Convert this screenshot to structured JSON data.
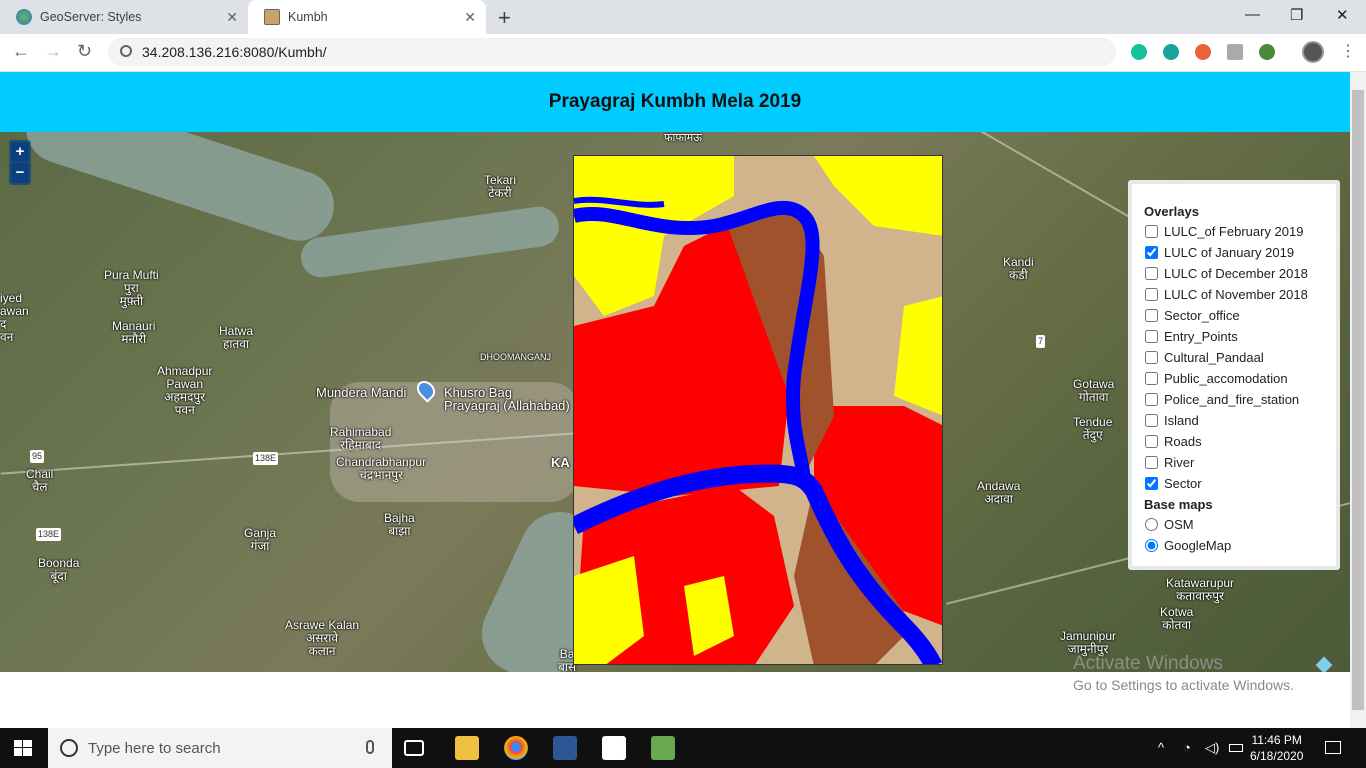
{
  "browser": {
    "tabs": [
      {
        "title": "GeoServer: Styles",
        "active": false
      },
      {
        "title": "Kumbh",
        "active": true
      }
    ],
    "url": "34.208.136.216:8080/Kumbh/",
    "new_tab_icon": "+",
    "back_icon": "←",
    "forward_icon": "→",
    "reload_icon": "↻",
    "minimize_icon": "—",
    "restore_icon": "❐",
    "close_icon": "✕"
  },
  "page": {
    "title": "Prayagraj Kumbh Mela 2019"
  },
  "map": {
    "zoom_in": "+",
    "zoom_out": "−",
    "places": [
      "Tekari\nटेकरी",
      "Pura Mufti\nपुरा\nमुफ़्ती",
      "Manauri\nमनौरी",
      "Hatwa\nहातवा",
      "Ahmadpur\nPawan\nअहमदपुर\nपवन",
      "Mundera Mandi",
      "Khusro Bag\nPrayagraj (Allahabad)",
      "Rahimabad\nरहिमाबाद",
      "Chandrabhanpur\nचंद्रभानपुर",
      "Bajha\nबाझा",
      "Ganja\nगंजा",
      "Boonda\nबूंदा",
      "Chail\nचैल",
      "Asrawe Kalan\nअसरावे\nकलान",
      "Kandi\nकंडी",
      "Gotawa\nगोतावा",
      "Tendue\nतेंदुए",
      "Andawa\nअदावा",
      "Katawarupur\nकतावारुपुर",
      "Kotwa\nकोतवा",
      "Jamunipur\nजामुनीपुर",
      "DHOOMANGANJ",
      "KA",
      "Ba\nबास",
      "iyed\nawan\nद\nवन",
      "फाफामऊ\nरूदापुर"
    ],
    "road_labels": [
      "138E",
      "138E",
      "95",
      "7"
    ],
    "colors": {
      "built_up": "#ff0000",
      "water": "#0000ff",
      "fallow": "#d2b48c",
      "sand": "#a0522d",
      "vegetation": "#ffff00",
      "header": "#00ccff"
    }
  },
  "layers": {
    "overlays_title": "Overlays",
    "overlays": [
      {
        "label": "LULC_of February 2019",
        "checked": false
      },
      {
        "label": "LULC of January 2019",
        "checked": true
      },
      {
        "label": "LULC of December 2018",
        "checked": false
      },
      {
        "label": "LULC of November 2018",
        "checked": false
      },
      {
        "label": "Sector_office",
        "checked": false
      },
      {
        "label": "Entry_Points",
        "checked": false
      },
      {
        "label": "Cultural_Pandaal",
        "checked": false
      },
      {
        "label": "Public_accomodation",
        "checked": false
      },
      {
        "label": "Police_and_fire_station",
        "checked": false
      },
      {
        "label": "Island",
        "checked": false
      },
      {
        "label": "Roads",
        "checked": false
      },
      {
        "label": "River",
        "checked": false
      },
      {
        "label": "Sector",
        "checked": true
      }
    ],
    "basemaps_title": "Base maps",
    "basemaps": [
      {
        "label": "OSM",
        "checked": false
      },
      {
        "label": "GoogleMap",
        "checked": true
      }
    ]
  },
  "watermark": {
    "line1": "Activate Windows",
    "line2": "Go to Settings to activate Windows."
  },
  "taskbar": {
    "search_placeholder": "Type here to search",
    "time": "11:46 PM",
    "date": "6/18/2020"
  }
}
